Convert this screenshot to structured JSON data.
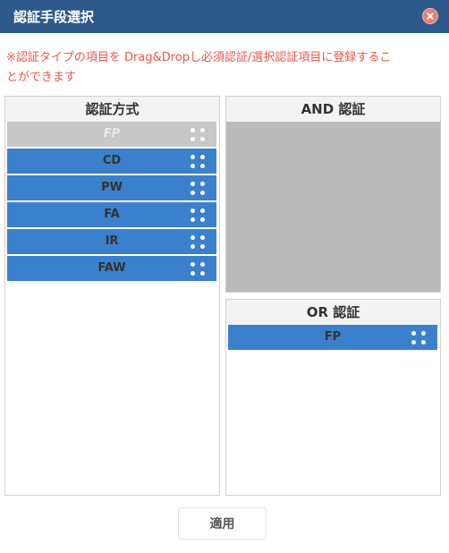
{
  "dialog": {
    "title": "認証手段選択",
    "close_icon": "close-icon",
    "notice_line1": "※認証タイプの項目を Drag&Dropし必須認証/選択認証項目に登録するこ",
    "notice_line2": "とができます"
  },
  "methods_panel": {
    "header": "認証方式",
    "items": [
      {
        "label": "FP",
        "state": "disabled"
      },
      {
        "label": "CD",
        "state": "available"
      },
      {
        "label": "PW",
        "state": "available"
      },
      {
        "label": "FA",
        "state": "available"
      },
      {
        "label": "IR",
        "state": "available"
      },
      {
        "label": "FAW",
        "state": "available"
      }
    ]
  },
  "and_panel": {
    "header": "AND 認証"
  },
  "or_panel": {
    "header": "OR 認証",
    "items": [
      {
        "label": "FP"
      }
    ]
  },
  "footer": {
    "apply_label": "適用"
  },
  "colors": {
    "titlebar": "#2d5a8a",
    "item": "#3b80cc",
    "item_disabled": "#c8c8c8",
    "dropzone": "#bbbbbb",
    "notice": "#e8564a"
  }
}
